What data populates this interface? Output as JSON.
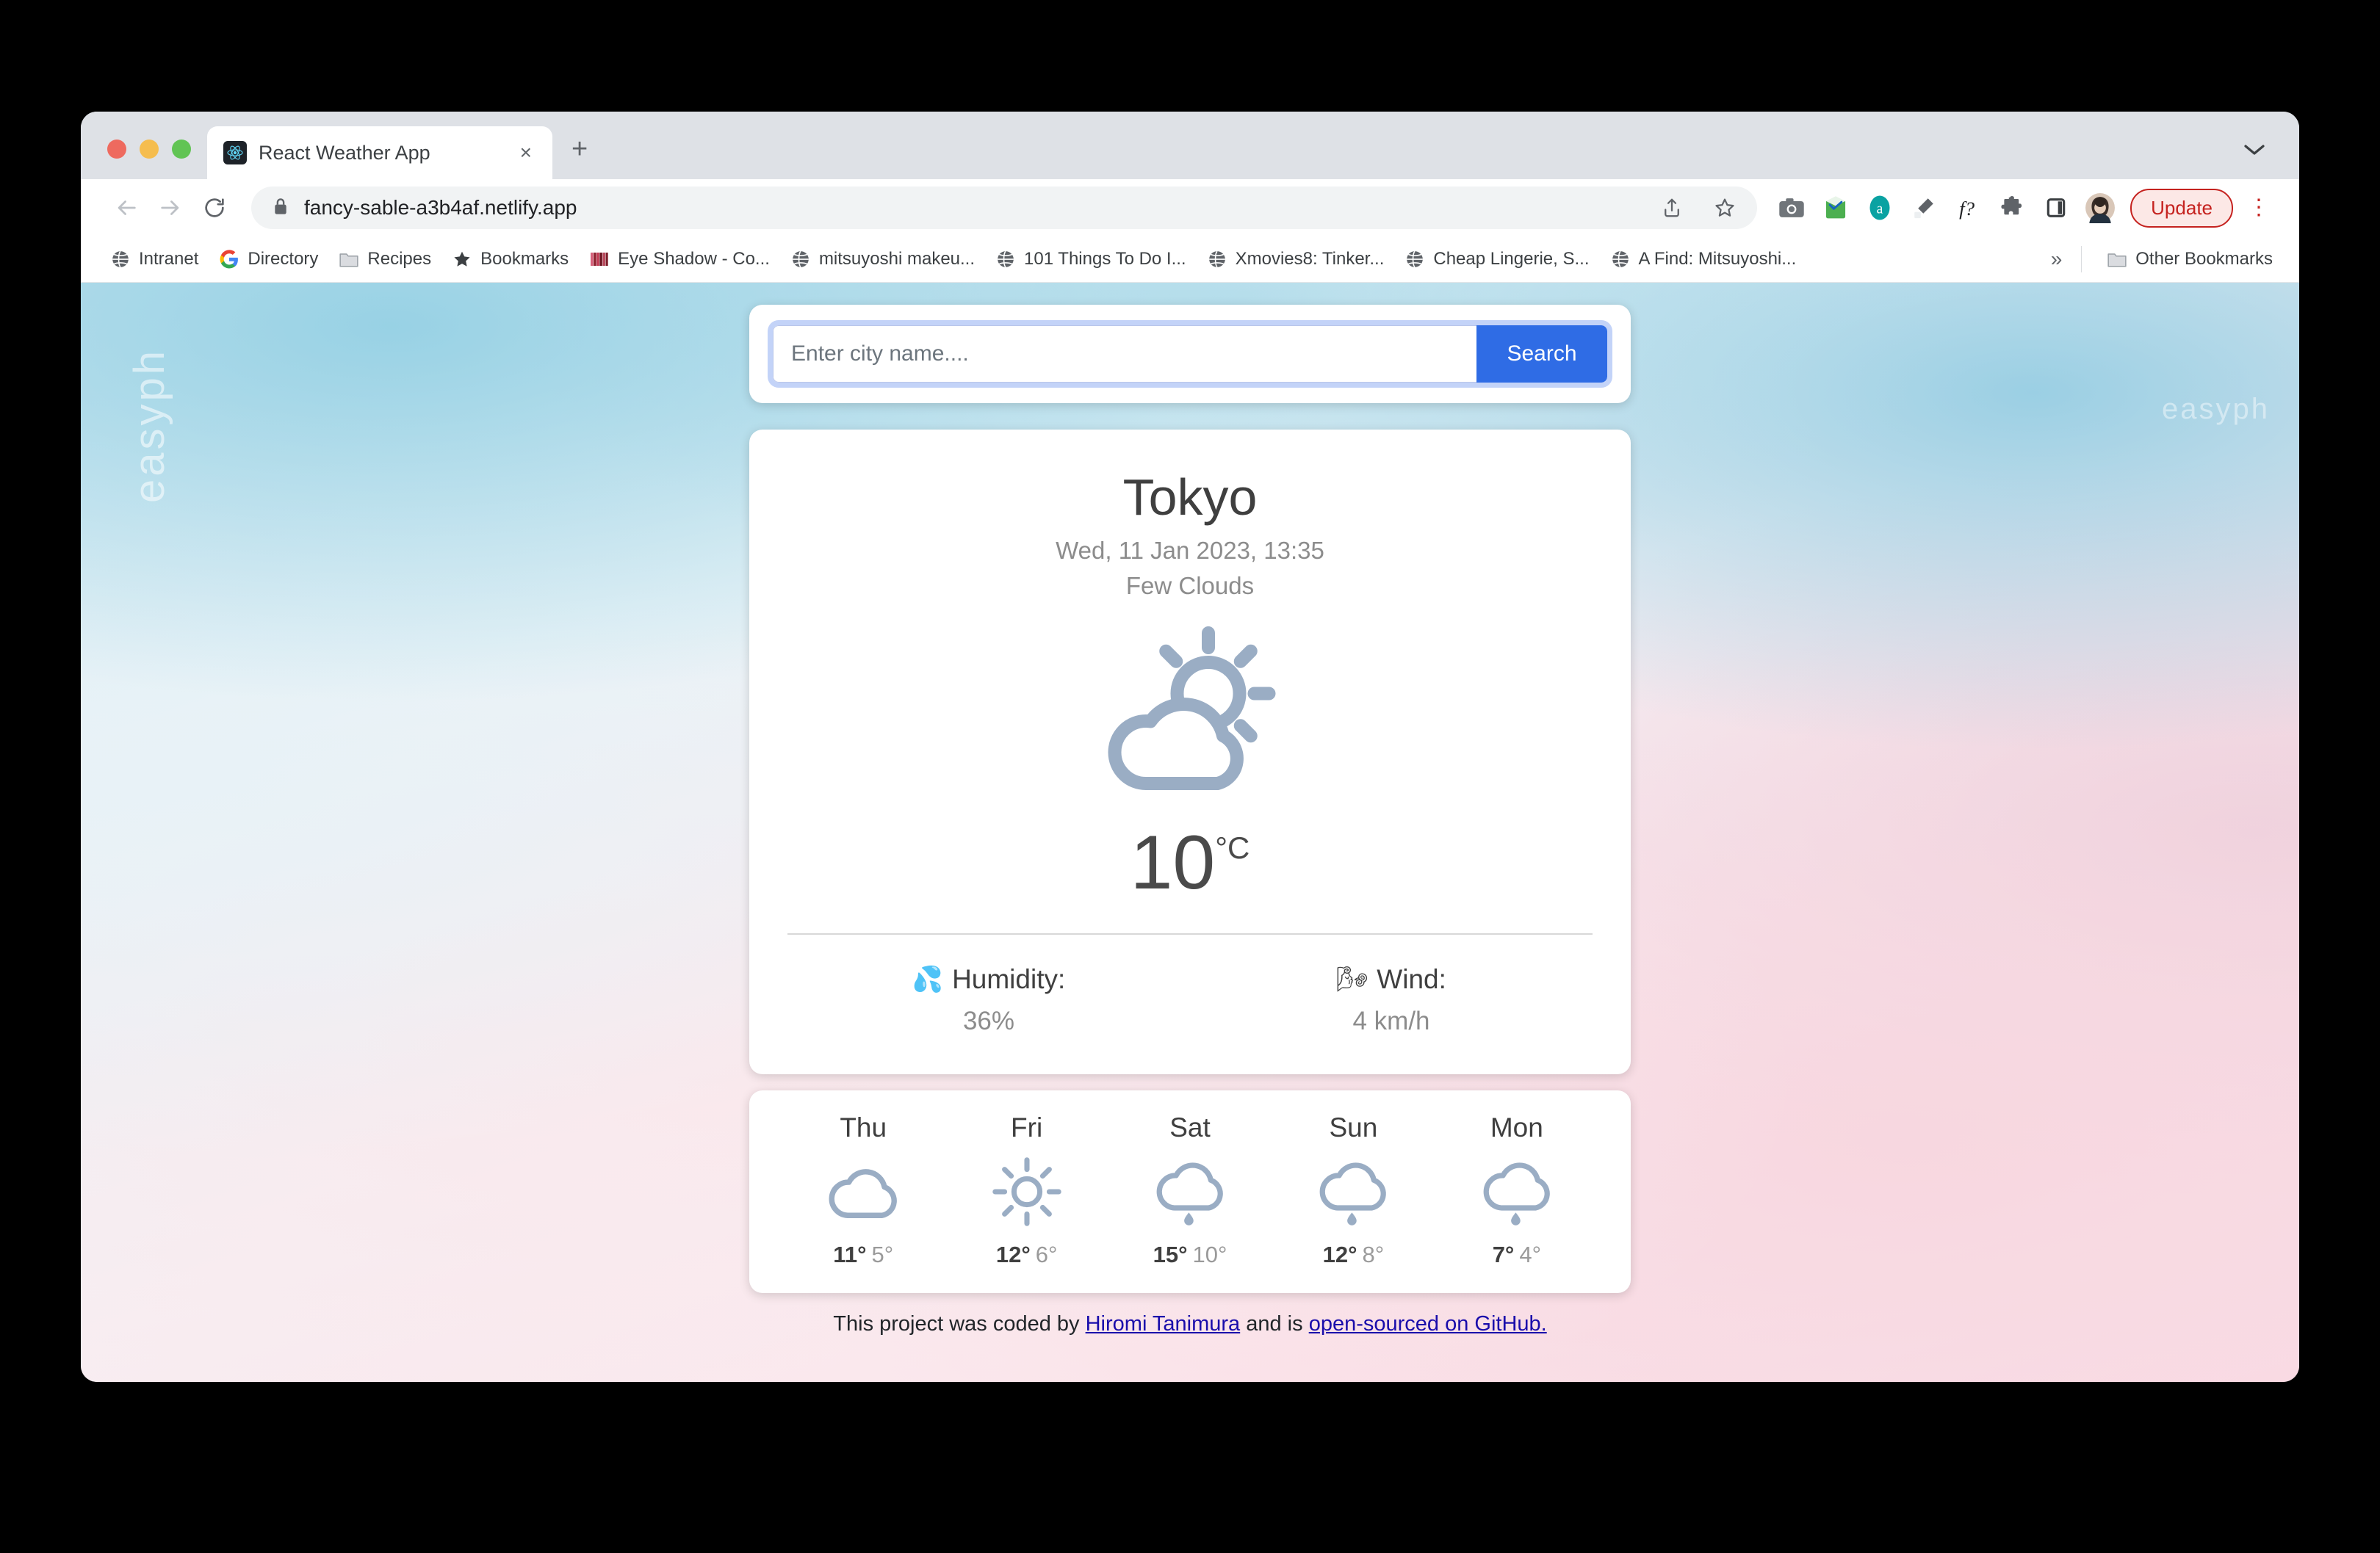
{
  "browser": {
    "tab": {
      "title": "React Weather App",
      "favicon": "react-logo",
      "close_label": "×"
    },
    "new_tab_label": "+",
    "tabstrip_chevron": "chevron-down-icon",
    "nav": {
      "back": "←",
      "forward": "→",
      "reload": "↻"
    },
    "omnibox": {
      "url": "fancy-sable-a3b4af.netlify.app",
      "lock": "lock-icon"
    },
    "omni_actions": [
      "share-icon",
      "bookmark-star-icon"
    ],
    "extensions": [
      "camera-icon",
      "grammarly-icon",
      "a-circle-icon",
      "eyedropper-icon",
      "f-question-icon",
      "puzzle-extensions-icon",
      "side-panel-icon",
      "profile-avatar"
    ],
    "update_label": "Update",
    "menu_label": "⋮",
    "bookmarks": [
      {
        "label": "Intranet",
        "icon": "globe-icon"
      },
      {
        "label": "Directory",
        "icon": "google-g-icon"
      },
      {
        "label": "Recipes",
        "icon": "folder-icon"
      },
      {
        "label": "Bookmarks",
        "icon": "star-icon"
      },
      {
        "label": "Eye Shadow - Co...",
        "icon": "stripes-icon"
      },
      {
        "label": "mitsuyoshi makeu...",
        "icon": "globe-icon"
      },
      {
        "label": "101 Things To Do I...",
        "icon": "globe-icon"
      },
      {
        "label": "Xmovies8: Tinker...",
        "icon": "globe-icon"
      },
      {
        "label": "Cheap Lingerie, S...",
        "icon": "globe-icon"
      },
      {
        "label": "A Find: Mitsuyoshi...",
        "icon": "globe-icon"
      }
    ],
    "bookmarks_overflow": "»",
    "other_bookmarks": {
      "label": "Other Bookmarks",
      "icon": "folder-icon"
    }
  },
  "watermark": {
    "left": "easyph",
    "right": "easyph"
  },
  "search": {
    "placeholder": "Enter city name....",
    "value": "",
    "button_label": "Search"
  },
  "current": {
    "city": "Tokyo",
    "datetime": "Wed, 11 Jan 2023, 13:35",
    "description": "Few Clouds",
    "icon": "few-clouds-icon",
    "temperature": "10",
    "unit": "°C",
    "humidity": {
      "label": "Humidity:",
      "value": "36%",
      "emoji": "💦"
    },
    "wind": {
      "label": "Wind:",
      "value": "4 km/h",
      "emoji": "🌬"
    }
  },
  "forecast": [
    {
      "day": "Thu",
      "icon": "cloud-icon",
      "max": "11°",
      "min": "5°"
    },
    {
      "day": "Fri",
      "icon": "sun-icon",
      "max": "12°",
      "min": "6°"
    },
    {
      "day": "Sat",
      "icon": "rain-icon",
      "max": "15°",
      "min": "10°"
    },
    {
      "day": "Sun",
      "icon": "rain-icon",
      "max": "12°",
      "min": "8°"
    },
    {
      "day": "Mon",
      "icon": "rain-icon",
      "max": "7°",
      "min": "4°"
    }
  ],
  "footer": {
    "prefix": "This project was coded by ",
    "author": "Hiromi Tanimura",
    "middle": " and is ",
    "repo": "open-sourced on GitHub."
  },
  "colors": {
    "accent_blue": "#2f6ce5",
    "focus_ring": "#c3d3f8",
    "weather_icon": "#9aadc4",
    "link": "#1a0dab",
    "update_red": "#c5221f"
  }
}
